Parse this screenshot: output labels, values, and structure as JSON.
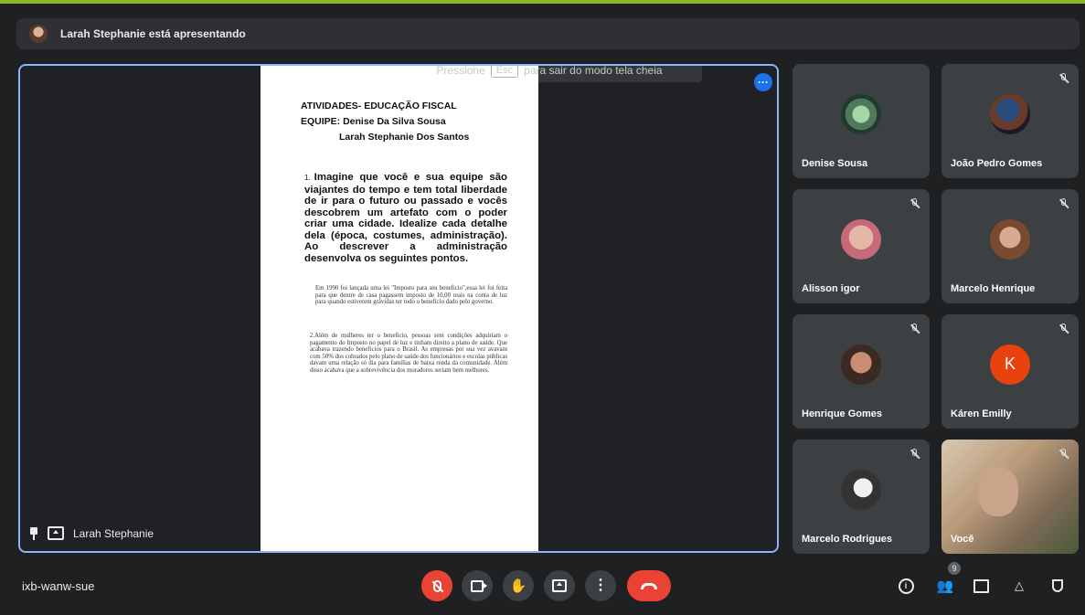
{
  "banner": {
    "presenting_text": "Larah Stephanie está apresentando"
  },
  "fullscreen_hint": {
    "before": "Pressione",
    "key": "Esc",
    "after": "para sair do modo tela cheia"
  },
  "document": {
    "title_line1": "ATIVIDADES- EDUCAÇÃO FISCAL",
    "title_line2": "EQUIPE: Denise Da Silva Sousa",
    "title_line3": "Larah Stephanie Dos Santos",
    "q1_number": "1.",
    "q1_text": "Imagine que você e sua equipe são viajantes do tempo e tem total liberdade de ir para o futuro ou passado e vocês descobrem um artefato com o poder criar uma cidade. Idealize cada detalhe dela (época, costumes, administração). Ao descrever a administração desenvolva os seguintes pontos.",
    "answer1": "Em 1990 foi lançada uma lei \"Imposto para seu beneficio\",essa lei foi feita para que dentre de casa pagassem imposto de 10,00 reais na conta de luz para quando estiverem grávidas ter todo o beneficio dado pelo governo.",
    "answer2": "2.Além de mulheres ter o beneficio, pessoas sem condições adquiriam o pagamento do Imposto no papel de luz e tinham direito a plano de saúde. Que acabava trazendo beneficios para o Brasil. As empresas por sua vez avavam com 50% dos cobrados pelo plano de saúde dos funcionários e escolas públicas davam uma relação só dia para famílias de baixa renda da comunidade. Além disso acabava que a sobrevivência dos moradores seriam bem melhores."
  },
  "stage": {
    "presenter_name": "Larah Stephanie"
  },
  "participants": [
    {
      "name": "Denise Sousa"
    },
    {
      "name": "João Pedro Gomes"
    },
    {
      "name": "Alisson igor"
    },
    {
      "name": "Marcelo Henrique"
    },
    {
      "name": "Henrique Gomes"
    },
    {
      "name": "Káren Emilly",
      "initial": "K"
    },
    {
      "name": "Marcelo Rodrigues"
    },
    {
      "name": "Você"
    }
  ],
  "bottom_bar": {
    "meeting_code": "ixb-wanw-sue",
    "people_count": "9"
  },
  "colors": {
    "accent": "#8ab4f8",
    "end_call": "#ea4335",
    "stripe": "#8bb428"
  }
}
